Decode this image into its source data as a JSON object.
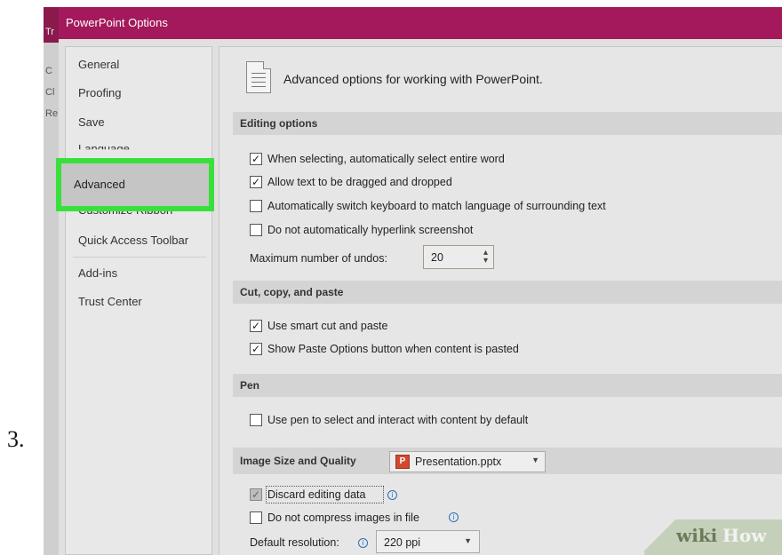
{
  "step_number": "3.",
  "window": {
    "title": "PowerPoint Options",
    "background_fragments": [
      "Tr",
      "C",
      "Cl",
      "Re"
    ]
  },
  "nav": {
    "items": [
      {
        "label": "General"
      },
      {
        "label": "Proofing"
      },
      {
        "label": "Save"
      },
      {
        "label": "Language"
      },
      {
        "label": "Advanced",
        "selected": true
      },
      {
        "label": "Customize Ribbon"
      },
      {
        "label": "Quick Access Toolbar"
      },
      {
        "label": "Add-ins"
      },
      {
        "label": "Trust Center"
      }
    ],
    "highlight_color": "#39e03b"
  },
  "content": {
    "header": "Advanced options for working with PowerPoint.",
    "sections": {
      "editing": {
        "title": "Editing options",
        "options": [
          {
            "label": "When selecting, automatically select entire word",
            "checked": true
          },
          {
            "label": "Allow text to be dragged and dropped",
            "checked": true
          },
          {
            "label": "Automatically switch keyboard to match language of surrounding text",
            "checked": false
          },
          {
            "label": "Do not automatically hyperlink screenshot",
            "checked": false
          }
        ],
        "undos_label": "Maximum number of undos:",
        "undos_value": "20"
      },
      "cut_copy": {
        "title": "Cut, copy, and paste",
        "options": [
          {
            "label": "Use smart cut and paste",
            "checked": true
          },
          {
            "label": "Show Paste Options button when content is pasted",
            "checked": true
          }
        ]
      },
      "pen": {
        "title": "Pen",
        "options": [
          {
            "label": "Use pen to select and interact with content by default",
            "checked": false
          }
        ]
      },
      "image": {
        "title": "Image Size and Quality",
        "file_select": "Presentation.pptx",
        "options": [
          {
            "label": "Discard editing data",
            "checked": true,
            "disabled": true
          },
          {
            "label": "Do not compress images in file",
            "checked": false
          }
        ],
        "resolution_label": "Default resolution:",
        "resolution_value": "220 ppi"
      }
    }
  },
  "watermark": {
    "part1": "wiki",
    "part2": "How"
  },
  "colors": {
    "titlebar": "#a3195b",
    "highlight": "#39e03b",
    "info": "#2b6fb8"
  }
}
